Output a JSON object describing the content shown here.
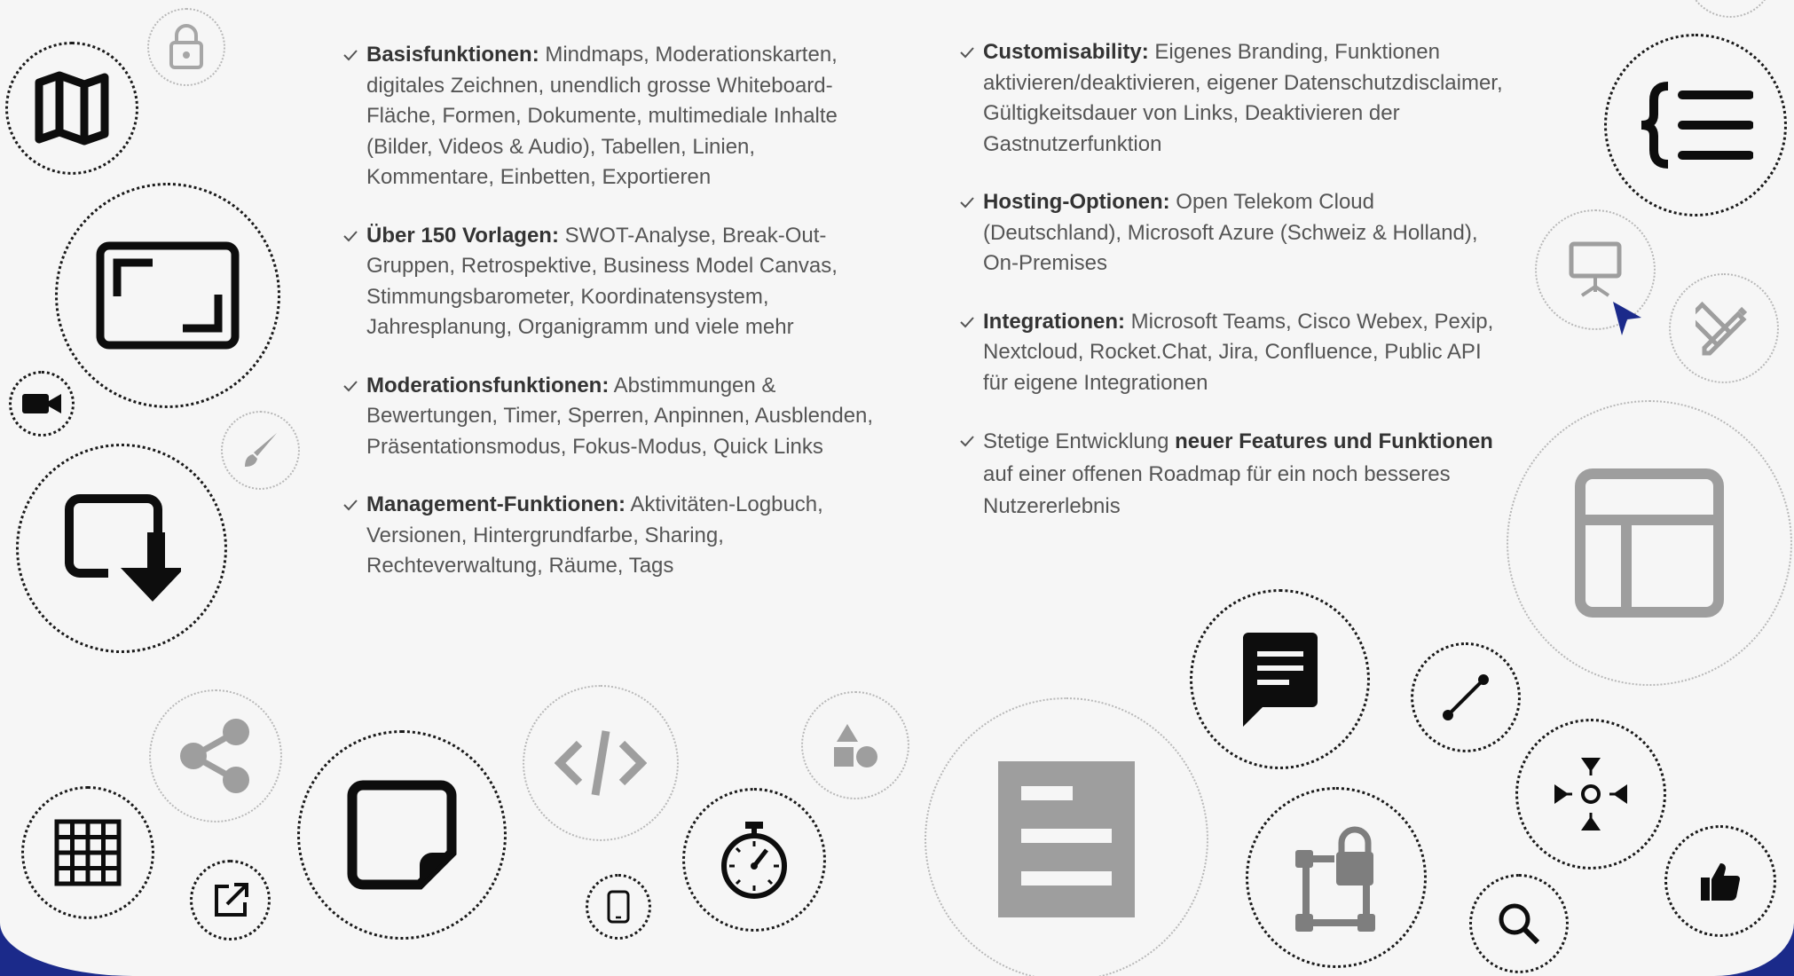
{
  "left_features": [
    {
      "title": "Basisfunktionen:",
      "text": " Mindmaps, Moderationskarten, digitales Zeichnen, unendlich grosse Whiteboard-Fläche, Formen, Dokumente, multimediale Inhalte (Bilder, Videos & Audio), Tabellen, Linien, Kommentare, Einbetten, Exportieren"
    },
    {
      "title": "Über 150 Vorlagen:",
      "text": " SWOT-Analyse, Break-Out-Gruppen, Retrospektive, Business Model Canvas, Stimmungsbarometer, Koordinatensystem, Jahresplanung, Organigramm und viele mehr"
    },
    {
      "title": "Moderationsfunktionen:",
      "text": " Abstimmungen & Bewertungen, Timer, Sperren, Anpinnen, Ausblenden, Präsentationsmodus, Fokus-Modus, Quick Links"
    },
    {
      "title": "Management-Funktionen:",
      "text": " Aktivitäten-Logbuch, Versionen, Hintergrundfarbe, Sharing, Rechteverwaltung, Räume, Tags"
    }
  ],
  "right_features": [
    {
      "title": "Customisability:",
      "text": " Eigenes Branding, Funktionen aktivieren/deaktivieren, eigener Datenschutzdisclaimer, Gültigkeitsdauer von Links, Deaktivieren der Gastnutzerfunktion"
    },
    {
      "title": "Hosting-Optionen:",
      "text": " Open Telekom Cloud (Deutschland), Microsoft Azure (Schweiz & Holland), On-Premises"
    },
    {
      "title": "Integrationen:",
      "text": " Microsoft Teams, Cisco Webex, Pexip, Nextcloud, Rocket.Chat, Jira, Confluence, Public API für eigene Integrationen"
    }
  ],
  "last_feature": {
    "before": "Stetige Entwicklung ",
    "bold": "neuer Features und Funktionen",
    "after": " auf einer offenen Roadmap für ein noch besseres Nutzererlebnis"
  },
  "icons": [
    "lock-icon",
    "map-icon",
    "fullscreen-icon",
    "video-camera-icon",
    "brush-icon",
    "download-box-icon",
    "share-icon",
    "grid-table-icon",
    "external-link-icon",
    "sticky-note-icon",
    "code-icon",
    "shapes-icon",
    "tablet-icon",
    "stopwatch-icon",
    "document-icon",
    "comment-icon",
    "crop-lock-icon",
    "line-icon",
    "focus-icon",
    "search-icon",
    "thumbs-up-icon",
    "layout-template-icon",
    "design-tools-icon",
    "presentation-icon",
    "mindmap-icon",
    "mouse-cursor-icon"
  ],
  "colors": {
    "background": "#f6f6f6",
    "icon_dark": "#0d0d0d",
    "icon_gray": "#9e9e9e",
    "accent_blue": "#1b2a8a",
    "text": "#555555"
  }
}
